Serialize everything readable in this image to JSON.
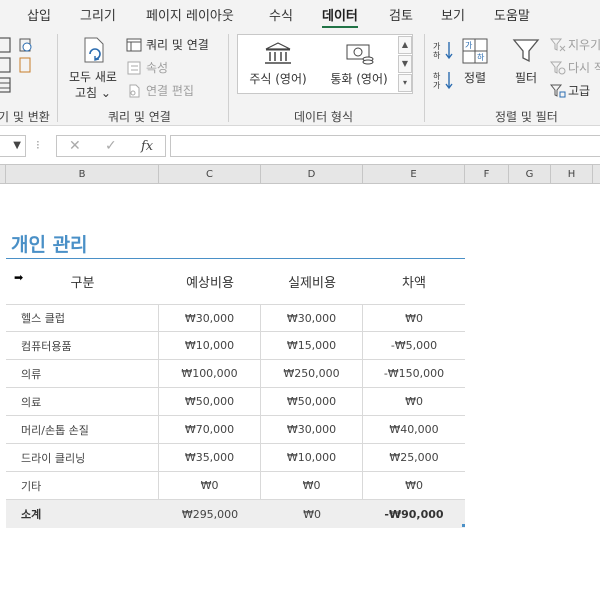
{
  "ribbon_tabs": [
    "삽입",
    "그리기",
    "페이지 레이아웃",
    "수식",
    "데이터",
    "검토",
    "보기",
    "도움말"
  ],
  "active_tab": "데이터",
  "ribbon": {
    "group_get_transform_label": "기 및 변환",
    "refresh_label_1": "모두 새로",
    "refresh_label_2": "고침 ⌄",
    "queries_label": "쿼리 및 연결",
    "properties_label": "속성",
    "edit_links_label": "연결 편집",
    "group_queries_label": "쿼리 및 연결",
    "stocks_label": "주식 (영어)",
    "currencies_label": "통화 (영어)",
    "group_datatypes_label": "데이터 형식",
    "sort_label": "정렬",
    "filter_label": "필터",
    "clear_label": "지우기",
    "reapply_label": "다시 적",
    "advanced_label": "고급",
    "group_sortfilter_label": "정렬 및 필터"
  },
  "formula_bar": {
    "cancel_glyph": "✕",
    "enter_glyph": "✓",
    "fx_glyph": "fx",
    "formula": ""
  },
  "columns": [
    "B",
    "C",
    "D",
    "E",
    "F",
    "G",
    "H"
  ],
  "sheet": {
    "title": "개인 관리",
    "headers": [
      "구분",
      "예상비용",
      "실제비용",
      "차액"
    ],
    "rows": [
      {
        "category": "헬스 클럽",
        "expected": "₩30,000",
        "actual": "₩30,000",
        "diff": "₩0"
      },
      {
        "category": "컴퓨터용품",
        "expected": "₩10,000",
        "actual": "₩15,000",
        "diff": "-₩5,000"
      },
      {
        "category": "의류",
        "expected": "₩100,000",
        "actual": "₩250,000",
        "diff": "-₩150,000"
      },
      {
        "category": "의료",
        "expected": "₩50,000",
        "actual": "₩50,000",
        "diff": "₩0"
      },
      {
        "category": "머리/손톱 손질",
        "expected": "₩70,000",
        "actual": "₩30,000",
        "diff": "₩40,000"
      },
      {
        "category": "드라이 클리닝",
        "expected": "₩35,000",
        "actual": "₩10,000",
        "diff": "₩25,000"
      },
      {
        "category": "기타",
        "expected": "₩0",
        "actual": "₩0",
        "diff": "₩0"
      }
    ],
    "total": {
      "category": "소계",
      "expected": "₩295,000",
      "actual": "₩0",
      "diff": "-₩90,000"
    }
  },
  "colors": {
    "accent": "#217346",
    "title": "#4a90c7"
  }
}
